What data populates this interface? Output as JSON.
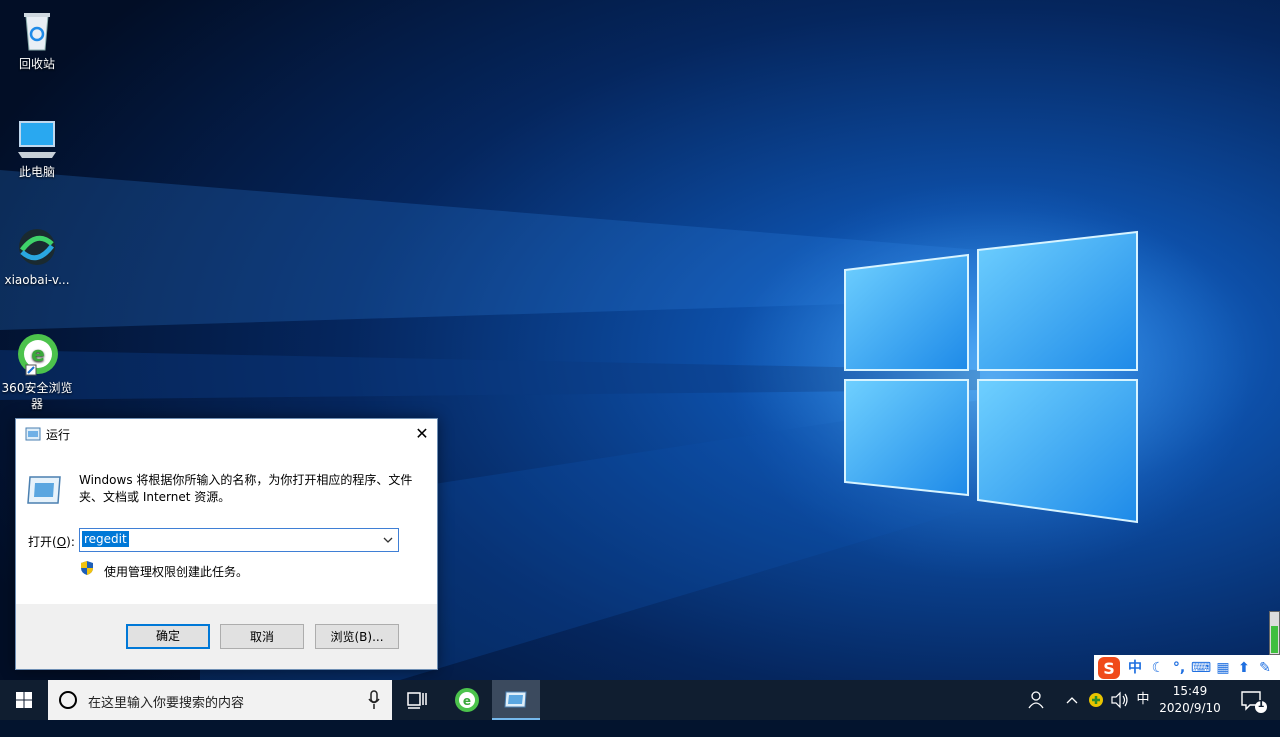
{
  "desktop": {
    "icons": [
      {
        "label": "回收站"
      },
      {
        "label": "此电脑"
      },
      {
        "label": "xiaobai-v..."
      },
      {
        "label": "360安全浏览器"
      }
    ]
  },
  "run_dialog": {
    "title": "运行",
    "close_glyph": "✕",
    "description": "Windows 将根据你所输入的名称，为你打开相应的程序、文件夹、文档或 Internet 资源。",
    "open_label_prefix": "打开(",
    "open_label_key": "O",
    "open_label_suffix": "):",
    "input_value": "regedit",
    "uac_text": "使用管理权限创建此任务。",
    "buttons": {
      "ok": "确定",
      "cancel": "取消",
      "browse": "浏览(B)..."
    }
  },
  "taskbar": {
    "search_placeholder": "在这里输入你要搜索的内容",
    "ime_mode": "中",
    "time": "15:49",
    "date": "2020/9/10",
    "notification_count": "1"
  },
  "ime_bar": {
    "logo": "S",
    "mode": "中"
  },
  "colors": {
    "accent": "#0078d7",
    "taskbar": "#101e30",
    "wallpaper_glow": "#4fb8ff"
  }
}
